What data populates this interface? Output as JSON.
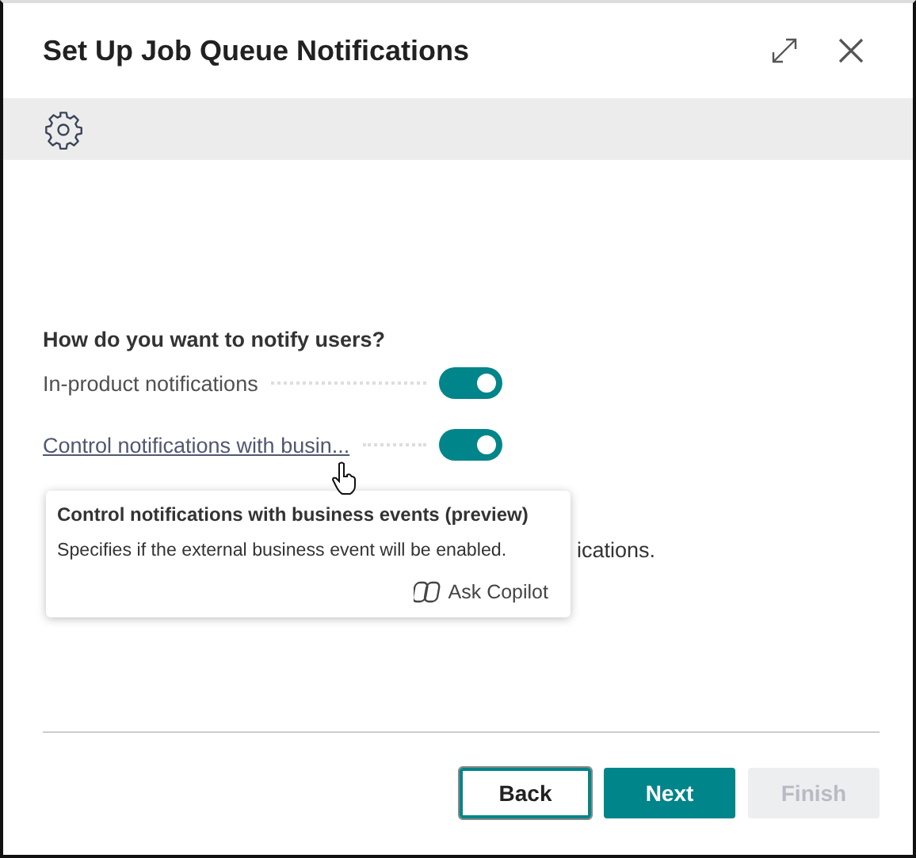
{
  "window": {
    "title": "Set Up Job Queue Notifications"
  },
  "question": "How do you want to notify users?",
  "options": [
    {
      "label": "In-product notifications",
      "kind": "plain",
      "on": true
    },
    {
      "label": "Control notifications with busin...",
      "kind": "link",
      "on": true
    }
  ],
  "partial_text": "ications.",
  "tooltip": {
    "title": "Control notifications with business events (preview)",
    "text": "Specifies if the external business event will be enabled.",
    "action": "Ask Copilot"
  },
  "buttons": [
    {
      "label": "Back",
      "kind": "outline",
      "disabled": false
    },
    {
      "label": "Next",
      "kind": "primary",
      "disabled": false
    },
    {
      "label": "Finish",
      "kind": "primary",
      "disabled": true
    }
  ]
}
